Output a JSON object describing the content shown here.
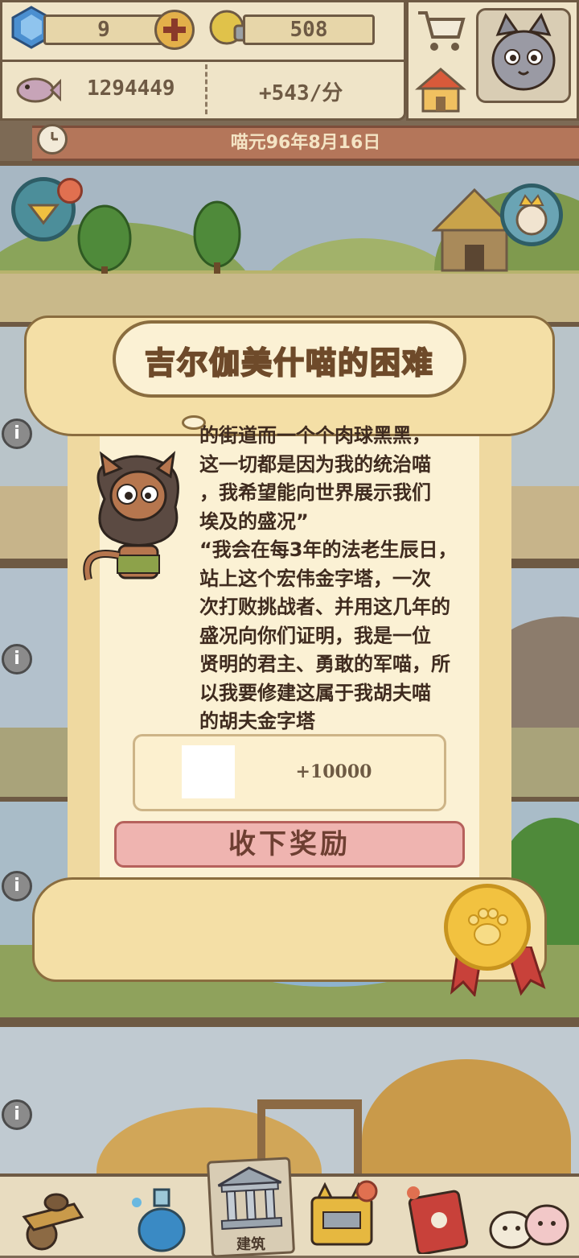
{
  "hud": {
    "gems": "9",
    "bulbs": "508",
    "fish": "1294449",
    "rate": "+543/分"
  },
  "date": "喵元96年8月16日",
  "dialog": {
    "title": "吉尔伽美什喵的困难",
    "lines": [
      "的街道而一个个肉球黑黑，",
      "这一切都是因为我的统治喵",
      "，我希望能向世界展示我们",
      "埃及的盛况”",
      "“我会在每3年的法老生辰日，",
      "站上这个宏伟金字塔，一次",
      "次打败挑战者、并用这几年的",
      "盛况向你们证明，我是一位",
      "贤明的君主、勇敢的军喵，所",
      "以我要修建这属于我胡夫喵",
      "的胡夫金字塔"
    ],
    "reward_amount": "+10000",
    "claim_label": "收下奖励"
  },
  "nav": {
    "build_label": "建筑"
  },
  "info_glyph": "i",
  "icons": [
    "gem-icon",
    "add-icon",
    "bulb-icon",
    "fish-icon",
    "cart-icon",
    "house-icon",
    "avatar",
    "clock-icon",
    "location-badge-icon",
    "king-cat-badge-icon",
    "info-icon",
    "paw-medal-icon",
    "cart-nav-icon",
    "potion-icon",
    "temple-icon",
    "cat-box-icon",
    "book-icon",
    "cats-icon"
  ]
}
